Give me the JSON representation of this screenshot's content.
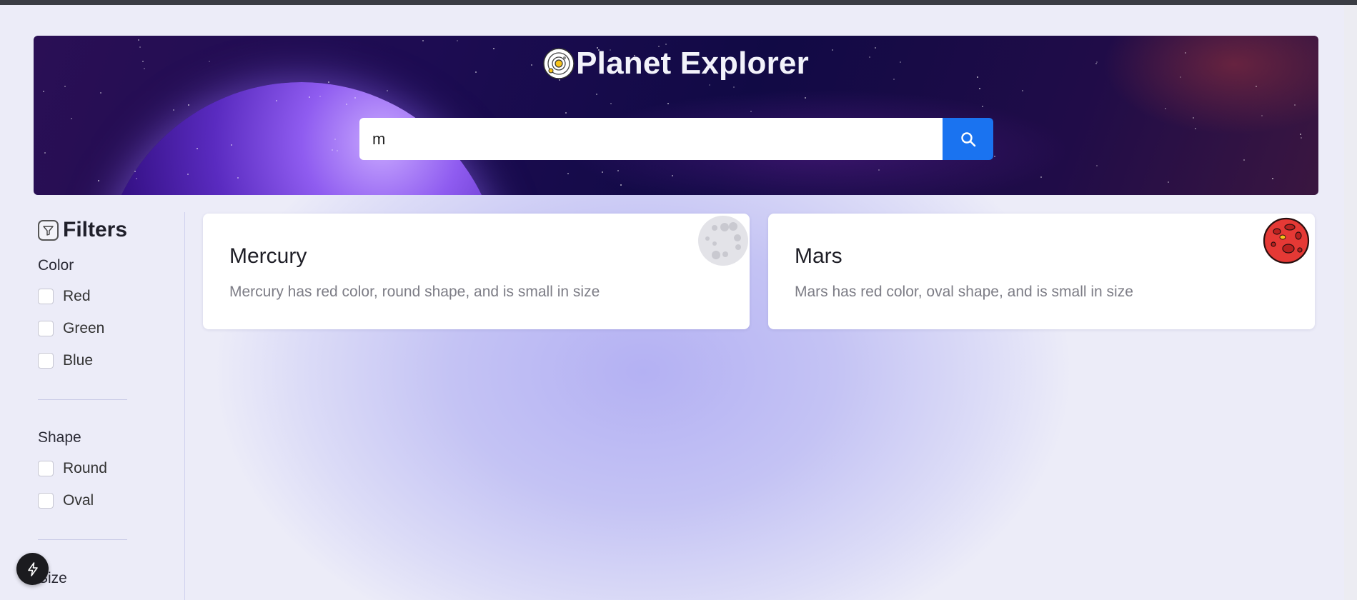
{
  "header": {
    "title": "Planet Explorer",
    "logo_icon": "solar-system-icon"
  },
  "search": {
    "value": "m",
    "placeholder": "",
    "button_icon": "search-icon"
  },
  "sidebar": {
    "heading": "Filters",
    "heading_icon": "filter-icon",
    "groups": [
      {
        "label": "Color",
        "options": [
          "Red",
          "Green",
          "Blue"
        ]
      },
      {
        "label": "Shape",
        "options": [
          "Round",
          "Oval"
        ]
      },
      {
        "label": "Size",
        "options": []
      }
    ]
  },
  "results": [
    {
      "name": "Mercury",
      "description": "Mercury has red color, round shape, and is small in size",
      "image_icon": "mercury-planet-icon"
    },
    {
      "name": "Mars",
      "description": "Mars has red color, oval shape, and is small in size",
      "image_icon": "mars-planet-icon"
    }
  ],
  "floating_button_icon": "lightning-icon",
  "colors": {
    "accent": "#1a73f0",
    "hero_dark": "#110a45",
    "mars_red": "#e53935"
  }
}
